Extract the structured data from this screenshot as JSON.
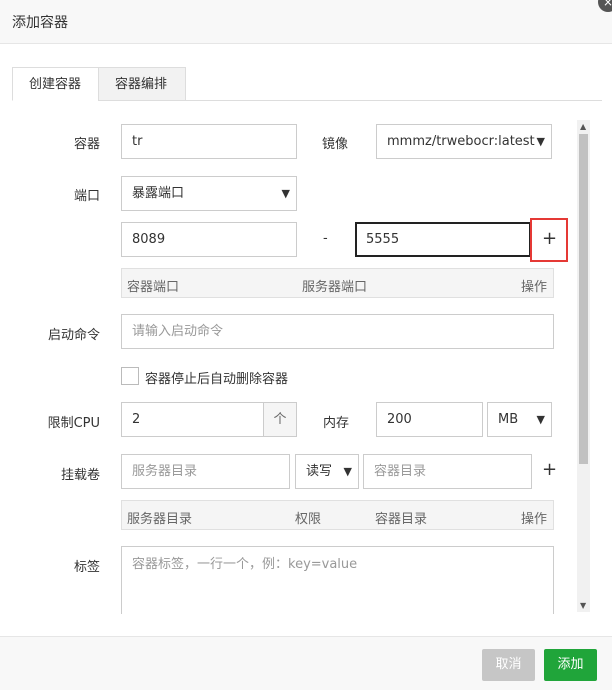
{
  "window": {
    "title": "添加容器",
    "close_glyph": "×"
  },
  "tabs": [
    {
      "label": "创建容器",
      "active": true
    },
    {
      "label": "容器编排",
      "active": false
    }
  ],
  "form": {
    "container": {
      "label": "容器",
      "value": "tr"
    },
    "image": {
      "label": "镜像",
      "value": "mmmz/trwebocr:latest"
    },
    "port": {
      "label": "端口",
      "mode": "暴露端口",
      "container_port": "8089",
      "separator": "-",
      "host_port": "5555",
      "add_glyph": "+"
    },
    "port_table": {
      "headers": [
        "容器端口",
        "服务器端口",
        "操作"
      ]
    },
    "command": {
      "label": "启动命令",
      "placeholder": "请输入启动命令"
    },
    "auto_remove": {
      "label": "容器停止后自动删除容器",
      "checked": false
    },
    "cpu": {
      "label": "限制CPU",
      "value": "2",
      "unit": "个"
    },
    "memory": {
      "label": "内存",
      "value": "200",
      "unit": "MB"
    },
    "volume": {
      "label": "挂载卷",
      "host_placeholder": "服务器目录",
      "permission": "读写",
      "container_placeholder": "容器目录",
      "add_glyph": "+"
    },
    "volume_table": {
      "headers": [
        "服务器目录",
        "权限",
        "容器目录",
        "操作"
      ]
    },
    "tags": {
      "label": "标签",
      "placeholder": "容器标签，一行一个，例：key=value"
    }
  },
  "footer": {
    "cancel_label": "取消",
    "add_label": "添加"
  },
  "colors": {
    "primary": "#20a53a",
    "cancel": "#c6c6c6",
    "highlight": "#e53935"
  }
}
